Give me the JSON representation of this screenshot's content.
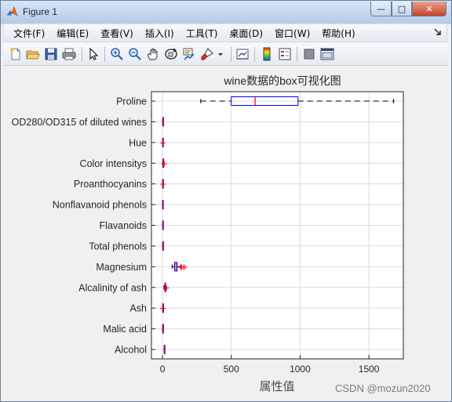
{
  "window": {
    "title": "Figure 1",
    "buttons": {
      "minimize": "—",
      "maximize": "□",
      "close": "✕"
    }
  },
  "menu": {
    "items": [
      "文件(F)",
      "编辑(E)",
      "查看(V)",
      "插入(I)",
      "工具(T)",
      "桌面(D)",
      "窗口(W)",
      "帮助(H)"
    ],
    "overflow_icon": "dock-arrow-icon"
  },
  "toolbar": {
    "icons": [
      "new-figure-icon",
      "open-file-icon",
      "save-icon",
      "print-icon",
      "edit-plot-arrow-icon",
      "zoom-in-icon",
      "zoom-out-icon",
      "pan-hand-icon",
      "rotate-3d-icon",
      "data-cursor-icon",
      "brush-icon",
      "brush-dropdown-icon",
      "link-plot-icon",
      "colorbar-icon",
      "legend-icon",
      "hide-plot-tools-icon",
      "show-plot-tools-icon"
    ]
  },
  "chart_data": {
    "type": "boxplot-horizontal",
    "title": "wine数据的box可视化图",
    "xlabel": "属性值",
    "ylabel": "",
    "xlim": [
      -80,
      1750
    ],
    "xticks": [
      0,
      500,
      1000,
      1500
    ],
    "grid": true,
    "box_color": "#0000ff",
    "median_color": "#ff0000",
    "whisker_color": "#000000",
    "categories": [
      "Proline",
      "OD280/OD315 of diluted wines",
      "Hue",
      "Color intensitys",
      "Proanthocyanins",
      "Nonflavanoid phenols",
      "Flavanoids",
      "Total phenols",
      "Magnesium",
      "Alcalinity of ash",
      "Ash",
      "Malic acid",
      "Alcohol"
    ],
    "boxes": [
      {
        "name": "Proline",
        "min": 278,
        "q1": 500,
        "median": 673,
        "q3": 985,
        "max": 1680,
        "outliers": []
      },
      {
        "name": "OD280/OD315 of diluted wines",
        "min": 1.27,
        "q1": 1.93,
        "median": 2.78,
        "q3": 3.17,
        "max": 4.0,
        "outliers": []
      },
      {
        "name": "Hue",
        "min": 0.48,
        "q1": 0.78,
        "median": 0.96,
        "q3": 1.12,
        "max": 1.45,
        "outliers": [
          1.71
        ]
      },
      {
        "name": "Color intensitys",
        "min": 1.28,
        "q1": 3.2,
        "median": 4.69,
        "q3": 6.2,
        "max": 10.8,
        "outliers": [
          11.75,
          13.0
        ]
      },
      {
        "name": "Proanthocyanins",
        "min": 0.41,
        "q1": 1.25,
        "median": 1.56,
        "q3": 1.95,
        "max": 2.96,
        "outliers": [
          3.28,
          3.58
        ]
      },
      {
        "name": "Nonflavanoid phenols",
        "min": 0.13,
        "q1": 0.27,
        "median": 0.34,
        "q3": 0.44,
        "max": 0.66,
        "outliers": []
      },
      {
        "name": "Flavanoids",
        "min": 0.34,
        "q1": 1.2,
        "median": 2.13,
        "q3": 2.88,
        "max": 5.08,
        "outliers": []
      },
      {
        "name": "Total phenols",
        "min": 0.98,
        "q1": 1.74,
        "median": 2.36,
        "q3": 2.8,
        "max": 3.88,
        "outliers": []
      },
      {
        "name": "Magnesium",
        "min": 70,
        "q1": 88,
        "median": 98,
        "q3": 107,
        "max": 132,
        "outliers": [
          134,
          139,
          151,
          162
        ]
      },
      {
        "name": "Alcalinity of ash",
        "min": 10.6,
        "q1": 17.2,
        "median": 19.5,
        "q3": 21.5,
        "max": 27.0,
        "outliers": [
          28.5,
          30.0
        ]
      },
      {
        "name": "Ash",
        "min": 1.7,
        "q1": 2.21,
        "median": 2.36,
        "q3": 2.56,
        "max": 3.07,
        "outliers": [
          1.36,
          3.22,
          3.23
        ]
      },
      {
        "name": "Malic acid",
        "min": 0.74,
        "q1": 1.6,
        "median": 1.87,
        "q3": 3.08,
        "max": 5.8,
        "outliers": []
      },
      {
        "name": "Alcohol",
        "min": 11.03,
        "q1": 12.36,
        "median": 13.05,
        "q3": 13.68,
        "max": 14.83,
        "outliers": []
      }
    ]
  },
  "watermark": "CSDN @mozun2020"
}
